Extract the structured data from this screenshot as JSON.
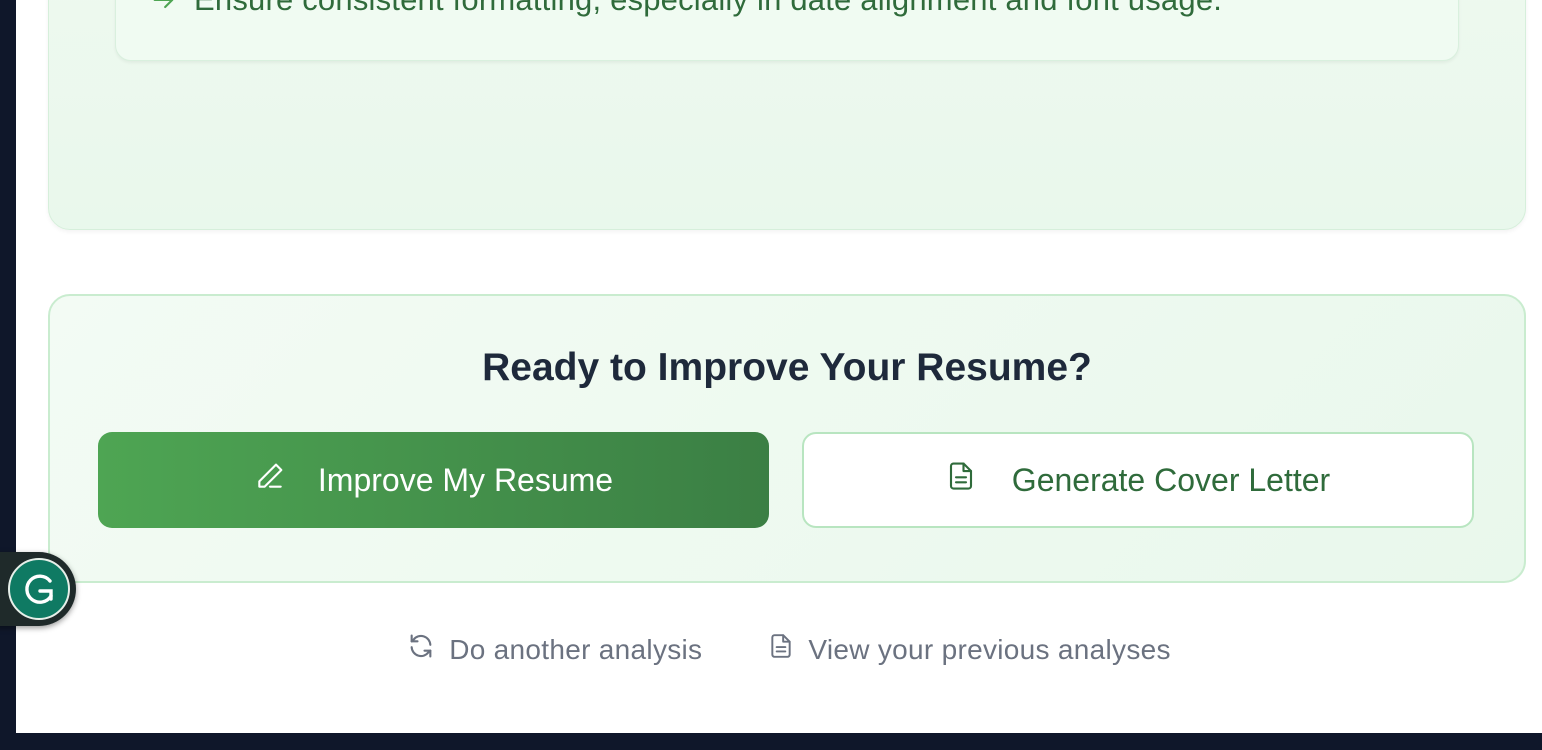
{
  "suggestions": {
    "tip_text": "Ensure consistent formatting, especially in date alignment and font usage.",
    "arrow_icon": "arrow-right-icon"
  },
  "cta": {
    "title": "Ready to Improve Your Resume?",
    "improve_button": {
      "label": "Improve My Resume",
      "icon": "pencil-icon"
    },
    "cover_letter_button": {
      "label": "Generate Cover Letter",
      "icon": "document-icon"
    }
  },
  "footer": {
    "another_analysis": {
      "label": "Do another analysis",
      "icon": "refresh-icon"
    },
    "previous_analyses": {
      "label": "View your previous analyses",
      "icon": "document-icon"
    }
  },
  "extension": {
    "icon": "grammarly-icon"
  },
  "colors": {
    "accent_green": "#4ea553",
    "accent_green_dark": "#3b7f44",
    "text_green": "#2f6b3b",
    "panel_bg": "#e9f8ec",
    "title_text": "#1e293b",
    "muted_text": "#6b7280"
  }
}
